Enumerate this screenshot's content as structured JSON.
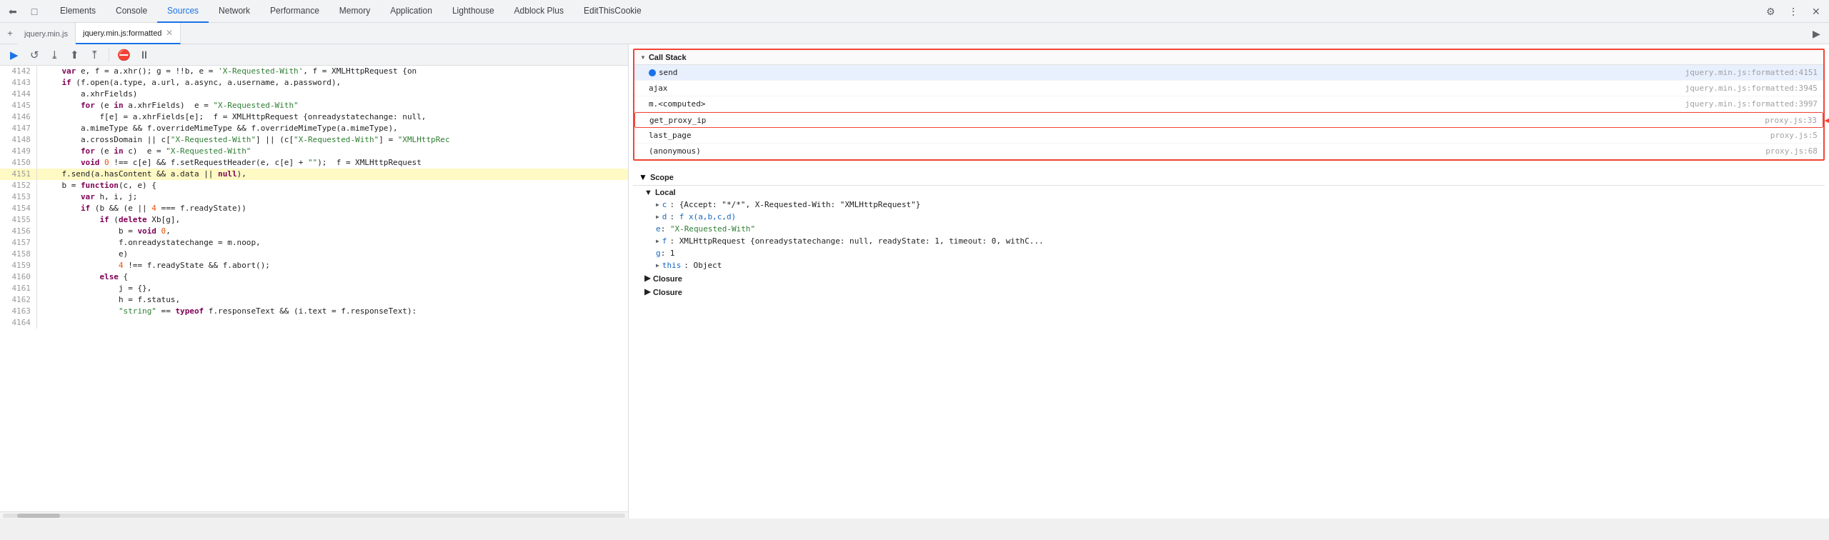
{
  "devtools": {
    "toolbar_icons": [
      "⬅",
      "□"
    ],
    "tabs": [
      {
        "label": "Elements",
        "active": false
      },
      {
        "label": "Console",
        "active": false
      },
      {
        "label": "Sources",
        "active": true
      },
      {
        "label": "Network",
        "active": false
      },
      {
        "label": "Performance",
        "active": false
      },
      {
        "label": "Memory",
        "active": false
      },
      {
        "label": "Application",
        "active": false
      },
      {
        "label": "Lighthouse",
        "active": false
      },
      {
        "label": "Adblock Plus",
        "active": false
      },
      {
        "label": "EditThisCookie",
        "active": false
      }
    ],
    "toolbar_right": [
      "⚙",
      "⋮",
      "✕"
    ]
  },
  "file_tabs": [
    {
      "label": "jquery.min.js",
      "active": false,
      "closeable": false
    },
    {
      "label": "jquery.min.js:formatted",
      "active": true,
      "closeable": true
    }
  ],
  "debug_controls": {
    "buttons": [
      "▶",
      "↺",
      "⤓",
      "⬆",
      "⤒",
      "⛔",
      "⏸"
    ]
  },
  "code": {
    "lines": [
      {
        "num": "4142",
        "text": "    var e, f = a.xhr(); g = !!b, e = X-Requested-With', f = XMLHttpRequest {on",
        "highlight": false
      },
      {
        "num": "4143",
        "text": "    if (f.open(a.type, a.url, a.async, a.username, a.password),",
        "highlight": false
      },
      {
        "num": "4144",
        "text": "        a.xhrFields)",
        "highlight": false
      },
      {
        "num": "4145",
        "text": "        for (e in a.xhrFields)  e = \"X-Requested-With\"",
        "highlight": false
      },
      {
        "num": "4146",
        "text": "            f[e] = a.xhrFields[e];  f = XMLHttpRequest {onreadystatechange: null,",
        "highlight": false
      },
      {
        "num": "4147",
        "text": "        a.mimeType && f.overrideMimeType && f.overrideMimeType(a.mimeType),",
        "highlight": false
      },
      {
        "num": "4148",
        "text": "        a.crossDomain || c[\"X-Requested-With\"] || (c[\"X-Requested-With\"] = \"XMLHttpRec",
        "highlight": false
      },
      {
        "num": "4149",
        "text": "        for (e in c)  e = \"X-Requested-With\"",
        "highlight": false
      },
      {
        "num": "4150",
        "text": "        void 0 !== c[e] && f.setRequestHeader(e, c[e] + \"\");  f = XMLHttpRequest",
        "highlight": false
      },
      {
        "num": "4151",
        "text": "    f.send(a.hasContent && a.data || null),",
        "highlight": true
      },
      {
        "num": "4152",
        "text": "    b = function(c, e) {",
        "highlight": false
      },
      {
        "num": "4153",
        "text": "        var h, i, j;",
        "highlight": false
      },
      {
        "num": "4154",
        "text": "        if (b && (e || 4 === f.readyState))",
        "highlight": false
      },
      {
        "num": "4155",
        "text": "            if (delete Xb[g],",
        "highlight": false
      },
      {
        "num": "4156",
        "text": "                b = void 0,",
        "highlight": false
      },
      {
        "num": "4157",
        "text": "                f.onreadystatechange = m.noop,",
        "highlight": false
      },
      {
        "num": "4158",
        "text": "                e)",
        "highlight": false
      },
      {
        "num": "4159",
        "text": "                4 !== f.readyState && f.abort();",
        "highlight": false
      },
      {
        "num": "4160",
        "text": "            else {",
        "highlight": false
      },
      {
        "num": "4161",
        "text": "                j = {},",
        "highlight": false
      },
      {
        "num": "4162",
        "text": "                h = f.status,",
        "highlight": false
      },
      {
        "num": "4163",
        "text": "                \"string\" == typeof f.responseText && (i.text = f.responseText):",
        "highlight": false
      },
      {
        "num": "4164",
        "text": "",
        "highlight": false
      }
    ]
  },
  "call_stack": {
    "title": "Call Stack",
    "items": [
      {
        "name": "send",
        "location": "jquery.min.js:formatted:4151",
        "active": true,
        "icon": "blue_dot"
      },
      {
        "name": "ajax",
        "location": "jquery.min.js:formatted:3945",
        "active": false,
        "icon": ""
      },
      {
        "name": "m.<computed>",
        "location": "jquery.min.js:formatted:3997",
        "active": false,
        "icon": ""
      },
      {
        "name": "get_proxy_ip",
        "location": "proxy.js:33",
        "active": false,
        "highlighted": true,
        "icon": ""
      },
      {
        "name": "last_page",
        "location": "proxy.js:5",
        "active": false,
        "icon": ""
      },
      {
        "name": "(anonymous)",
        "location": "proxy.js:68",
        "active": false,
        "icon": ""
      }
    ]
  },
  "scope": {
    "title": "Scope",
    "local": {
      "label": "Local",
      "items": [
        {
          "key": "c",
          "value": "{Accept: \"*/*\", X-Requested-With: \"XMLHttpRequest\"}"
        },
        {
          "key": "d",
          "value": "f x(a,b,c,d)"
        },
        {
          "key": "e",
          "value": "\"X-Requested-With\""
        },
        {
          "key": "f",
          "value": "XMLHttpRequest {onreadystatechange: null, readyState: 1, timeout: 0, withC..."
        },
        {
          "key": "g",
          "value": "1"
        },
        {
          "key": "this",
          "value": "Object"
        }
      ]
    },
    "closure1": {
      "label": "Closure"
    },
    "closure2": {
      "label": "Closure"
    }
  }
}
